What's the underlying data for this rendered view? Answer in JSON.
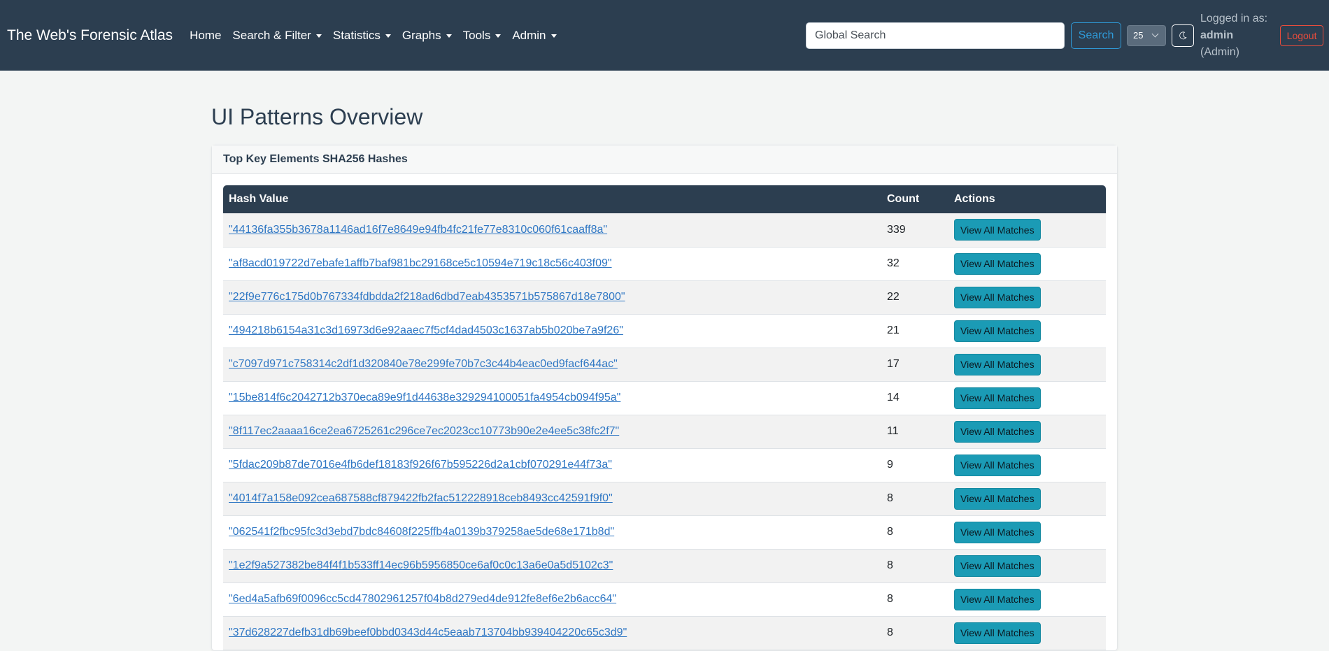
{
  "navbar": {
    "brand": "The Web's Forensic Atlas",
    "items": [
      {
        "label": "Home",
        "dropdown": false
      },
      {
        "label": "Search & Filter",
        "dropdown": true
      },
      {
        "label": "Statistics",
        "dropdown": true
      },
      {
        "label": "Graphs",
        "dropdown": true
      },
      {
        "label": "Tools",
        "dropdown": true
      },
      {
        "label": "Admin",
        "dropdown": true
      }
    ],
    "search_placeholder": "Global Search",
    "search_button": "Search",
    "page_size_value": "25",
    "logged_in_label": "Logged in as:",
    "username": "admin",
    "role": "(Admin)",
    "logout_label": "Logout"
  },
  "main": {
    "title": "UI Patterns Overview",
    "card_title": "Top Key Elements SHA256 Hashes",
    "table": {
      "headers": {
        "hash": "Hash Value",
        "count": "Count",
        "actions": "Actions"
      },
      "action_label": "View All Matches",
      "rows": [
        {
          "hash": "\"44136fa355b3678a1146ad16f7e8649e94fb4fc21fe77e8310c060f61caaff8a\"",
          "count": "339"
        },
        {
          "hash": "\"af8acd019722d7ebafe1affb7baf981bc29168ce5c10594e719c18c56c403f09\"",
          "count": "32"
        },
        {
          "hash": "\"22f9e776c175d0b767334fdbdda2f218ad6dbd7eab4353571b575867d18e7800\"",
          "count": "22"
        },
        {
          "hash": "\"494218b6154a31c3d16973d6e92aaec7f5cf4dad4503c1637ab5b020be7a9f26\"",
          "count": "21"
        },
        {
          "hash": "\"c7097d971c758314c2df1d320840e78e299fe70b7c3c44b4eac0ed9facf644ac\"",
          "count": "17"
        },
        {
          "hash": "\"15be814f6c2042712b370eca89e9f1d44638e329294100051fa4954cb094f95a\"",
          "count": "14"
        },
        {
          "hash": "\"8f117ec2aaaa16ce2ea6725261c296ce7ec2023cc10773b90e2e4ee5c38fc2f7\"",
          "count": "11"
        },
        {
          "hash": "\"5fdac209b87de7016e4fb6def18183f926f67b595226d2a1cbf070291e44f73a\"",
          "count": "9"
        },
        {
          "hash": "\"4014f7a158e092cea687588cf879422fb2fac512228918ceb8493cc42591f9f0\"",
          "count": "8"
        },
        {
          "hash": "\"062541f2fbc95fc3d3ebd7bdc84608f225ffb4a0139b379258ae5de68e171b8d\"",
          "count": "8"
        },
        {
          "hash": "\"1e2f9a527382be84f4f1b533ff14ec96b5956850ce6af0c0c13a6e0a5d5102c3\"",
          "count": "8"
        },
        {
          "hash": "\"6ed4a5afb69f0096cc5cd47802961257f04b8d279ed4de912fe8ef6e2b6acc64\"",
          "count": "8"
        },
        {
          "hash": "\"37d628227defb31db69beef0bbd0343d44c5eaab713704bb939404220c65c3d9\"",
          "count": "8"
        }
      ]
    }
  },
  "colors": {
    "navbar_bg": "#2c3e50",
    "accent_info": "#1b9bb5",
    "link": "#2f77c4",
    "danger": "#e74c3c"
  }
}
